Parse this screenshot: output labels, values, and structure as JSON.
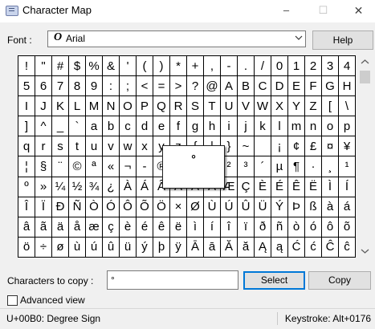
{
  "window": {
    "title": "Character Map",
    "icon": "character-map-app-icon",
    "controls": {
      "minimize": "–",
      "maximize": "☐",
      "close": "✕"
    }
  },
  "font": {
    "label": "Font :",
    "value": "Arial",
    "icon_glyph": "O"
  },
  "help_label": "Help",
  "grid": {
    "rows": [
      [
        "!",
        "\"",
        "#",
        "$",
        "%",
        "&",
        "'",
        "(",
        ")",
        "*",
        "+",
        ",",
        "-",
        ".",
        "/",
        "0",
        "1",
        "2",
        "3",
        "4"
      ],
      [
        "5",
        "6",
        "7",
        "8",
        "9",
        ":",
        ";",
        "<",
        "=",
        ">",
        "?",
        "@",
        "A",
        "B",
        "C",
        "D",
        "E",
        "F",
        "G",
        "H"
      ],
      [
        "I",
        "J",
        "K",
        "L",
        "M",
        "N",
        "O",
        "P",
        "Q",
        "R",
        "S",
        "T",
        "U",
        "V",
        "W",
        "X",
        "Y",
        "Z",
        "[",
        "\\"
      ],
      [
        "]",
        "^",
        "_",
        "`",
        "a",
        "b",
        "c",
        "d",
        "e",
        "f",
        "g",
        "h",
        "i",
        "j",
        "k",
        "l",
        "m",
        "n",
        "o",
        "p"
      ],
      [
        "q",
        "r",
        "s",
        "t",
        "u",
        "v",
        "w",
        "x",
        "y",
        "z",
        "{",
        "|",
        "}",
        "~",
        " ",
        "¡",
        "¢",
        "£",
        "¤",
        "¥"
      ],
      [
        "¦",
        "§",
        "¨",
        "©",
        "ª",
        "«",
        "¬",
        "-",
        "®",
        "¯",
        "°",
        "±",
        "²",
        "³",
        "´",
        "µ",
        "¶",
        "·",
        "¸",
        "¹"
      ],
      [
        "º",
        "»",
        "¼",
        "½",
        "¾",
        "¿",
        "À",
        "Á",
        "Â",
        "Ã",
        "Ä",
        "Å",
        "Æ",
        "Ç",
        "È",
        "É",
        "Ê",
        "Ë",
        "Ì",
        "Í"
      ],
      [
        "Î",
        "Ï",
        "Ð",
        "Ñ",
        "Ò",
        "Ó",
        "Ô",
        "Õ",
        "Ö",
        "×",
        "Ø",
        "Ù",
        "Ú",
        "Û",
        "Ü",
        "Ý",
        "Þ",
        "ß",
        "à",
        "á"
      ],
      [
        "â",
        "ã",
        "ä",
        "å",
        "æ",
        "ç",
        "è",
        "é",
        "ê",
        "ë",
        "ì",
        "í",
        "î",
        "ï",
        "ð",
        "ñ",
        "ò",
        "ó",
        "ô",
        "õ"
      ],
      [
        "ö",
        "÷",
        "ø",
        "ù",
        "ú",
        "û",
        "ü",
        "ý",
        "þ",
        "ÿ",
        "Ā",
        "ā",
        "Ă",
        "ă",
        "Ą",
        "ą",
        "Ć",
        "ć",
        "Ĉ",
        "ĉ"
      ]
    ],
    "selected": {
      "row": 5,
      "col": 10
    },
    "magnified_char": "°"
  },
  "copy": {
    "label": "Characters to copy :",
    "value": "°",
    "select_label": "Select",
    "copy_label": "Copy"
  },
  "advanced": {
    "label": "Advanced view",
    "checked": false
  },
  "status": {
    "left": "U+00B0: Degree Sign",
    "right": "Keystroke: Alt+0176"
  },
  "colors": {
    "focus_border": "#0078d7",
    "window_bg": "#f0f0f0"
  }
}
